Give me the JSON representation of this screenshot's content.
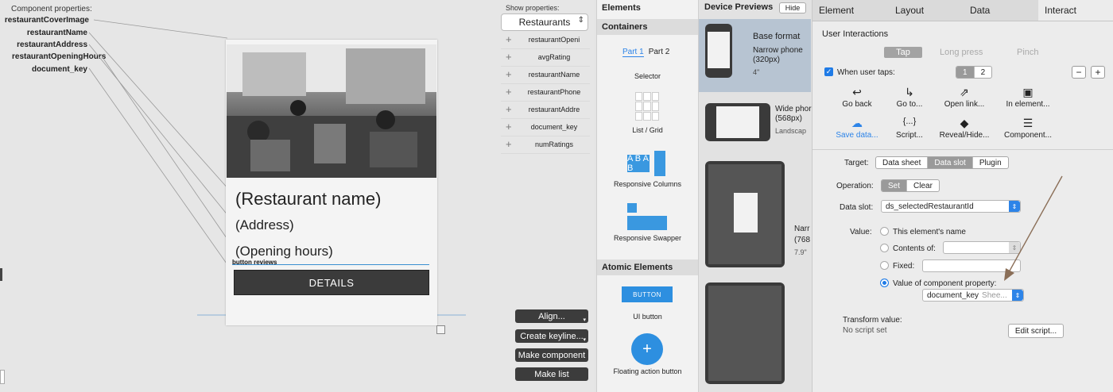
{
  "canvas": {
    "component_properties_title": "Component properties:",
    "component_properties": [
      "restaurantCoverImage",
      "restaurantName",
      "restaurantAddress",
      "restaurantOpeningHours",
      "document_key"
    ],
    "card": {
      "restaurant_name": "(Restaurant name)",
      "address": "(Address)",
      "opening_hours": "(Opening hours)",
      "button_label_caption": "button reviews",
      "details_button": "DETAILS"
    },
    "show_properties_title": "Show properties:",
    "show_properties_selected": "Restaurants",
    "show_properties_list": [
      "restaurantOpeni",
      "avgRating",
      "restaurantName",
      "restaurantPhone",
      "restaurantAddre",
      "document_key",
      "numRatings"
    ],
    "buttons": {
      "align": "Align...",
      "create_keyline": "Create keyline...",
      "make_component": "Make component",
      "make_list": "Make list"
    }
  },
  "elements": {
    "title": "Elements",
    "containers_header": "Containers",
    "tabs": [
      "Part 1",
      "Part 2"
    ],
    "selector": "Selector",
    "list_grid": "List / Grid",
    "responsive_columns": "Responsive Columns",
    "responsive_swapper": "Responsive Swapper",
    "atomic_header": "Atomic Elements",
    "ui_button_chip": "BUTTON",
    "ui_button": "UI button",
    "fab": "Floating action button",
    "abab": "A B A B"
  },
  "previews": {
    "title": "Device Previews",
    "hide": "Hide",
    "items": [
      {
        "title": "Base format",
        "subtitle": "Narrow phone (320px)",
        "size": "4\""
      },
      {
        "title": "Wide phor",
        "subtitle": "(568px)",
        "size": "Landscap"
      },
      {
        "title": "Narr",
        "subtitle": "(768",
        "size": "7.9\""
      }
    ]
  },
  "interact": {
    "tabs": [
      "Element",
      "Layout",
      "Data",
      "Interact"
    ],
    "section_title": "User Interactions",
    "gesture_tabs": [
      "Tap",
      "Long press",
      "Pinch"
    ],
    "when_user_taps": "When user taps:",
    "step_numbers": [
      "1",
      "2"
    ],
    "actions": [
      {
        "label": "Go back",
        "icon": "↩"
      },
      {
        "label": "Go to...",
        "icon": "↳"
      },
      {
        "label": "Open link...",
        "icon": "⇗"
      },
      {
        "label": "In element...",
        "icon": "▣"
      },
      {
        "label": "Save data...",
        "icon": "☁"
      },
      {
        "label": "Script...",
        "icon": "{...}"
      },
      {
        "label": "Reveal/Hide...",
        "icon": "◆"
      },
      {
        "label": "Component...",
        "icon": "☰"
      }
    ],
    "target_label": "Target:",
    "target_options": [
      "Data sheet",
      "Data slot",
      "Plugin"
    ],
    "operation_label": "Operation:",
    "operation_options": [
      "Set",
      "Clear"
    ],
    "data_slot_label": "Data slot:",
    "data_slot_value": "ds_selectedRestaurantId",
    "value_label": "Value:",
    "value_options": [
      "This element's name",
      "Contents of:",
      "Fixed:",
      "Value of component property:"
    ],
    "component_property_value": "document_key",
    "component_property_hint": "Shee...",
    "transform_title": "Transform value:",
    "transform_status": "No script set",
    "edit_script": "Edit script...",
    "colors": {
      "accent": "#1f7be6",
      "arrow": "#8a6e57"
    }
  }
}
